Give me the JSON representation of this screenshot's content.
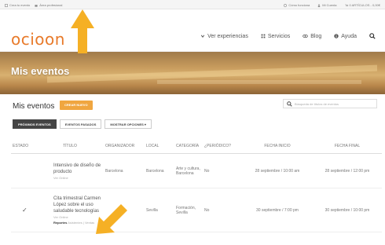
{
  "topbar": {
    "left": [
      {
        "label": "Crea tu evento",
        "icon": "create-icon"
      },
      {
        "label": "Área profesional",
        "icon": "briefcase-icon"
      }
    ],
    "right": [
      {
        "label": "Cómo funciona",
        "icon": "help-icon"
      },
      {
        "label": "Mi Cuenta",
        "icon": "user-icon"
      },
      {
        "label": "0 ARTÍCULOS - 0,00€",
        "icon": "cart-icon"
      }
    ]
  },
  "header": {
    "logo": "ocioon",
    "nav": [
      {
        "label": "Ver experiencias",
        "icon": "chevron-down-icon"
      },
      {
        "label": "Servicios",
        "icon": "grid-icon"
      },
      {
        "label": "Blog",
        "icon": "eye-icon"
      },
      {
        "label": "Ayuda",
        "icon": "info-icon"
      }
    ],
    "search_icon": "search-icon"
  },
  "banner": {
    "title": "Mis eventos"
  },
  "main": {
    "section_title": "Mis eventos",
    "new_button": "CREAR NUEVO",
    "search_placeholder": "Búsqueda de títulos de eventos",
    "filters": [
      {
        "label": "PRÓXIMOS EVENTOS",
        "active": true
      },
      {
        "label": "EVENTOS PASADOS",
        "active": false
      },
      {
        "label": "MOSTRAR OPCIONES ▾",
        "active": false
      }
    ]
  },
  "table": {
    "headers": {
      "estado": "ESTADO",
      "titulo": "TÍTULO",
      "organizador": "ORGANIZADOR",
      "local": "LOCAL",
      "categoria": "CATEGORÍA",
      "periodico": "¿PERIÓDICO?",
      "fecha_inicio": "FECHA INICIO",
      "fecha_final": "FECHA FINAL"
    },
    "rows": [
      {
        "estado": "",
        "titulo": "Intensivo de diseño de producto",
        "link": "Ver Online",
        "organizador": "Barcelona",
        "local": "Barcelona",
        "categoria": "Arte y cultura, Barcelona",
        "periodico": "No",
        "fecha_inicio": "28 septiembre / 10:00 am",
        "fecha_final": "28 septiembre / 12:00 pm"
      },
      {
        "estado": "✓",
        "titulo": "Cita trimestral Carmen López sobre el uso saludable tecnologías",
        "link": "Ver Online",
        "reportes_label": "Reportes",
        "reportes_links": "Asistentes | Ventas",
        "organizador": "",
        "local": "Sevilla",
        "categoria": "Formación, Sevilla",
        "periodico": "No",
        "fecha_inicio": "30 septiembre / 7:00 pm",
        "fecha_final": "30 septiembre / 10:00 pm"
      }
    ]
  },
  "colors": {
    "accent": "#e87a2a",
    "button": "#f0a640",
    "arrow": "#f5b025",
    "active_filter": "#444444"
  }
}
